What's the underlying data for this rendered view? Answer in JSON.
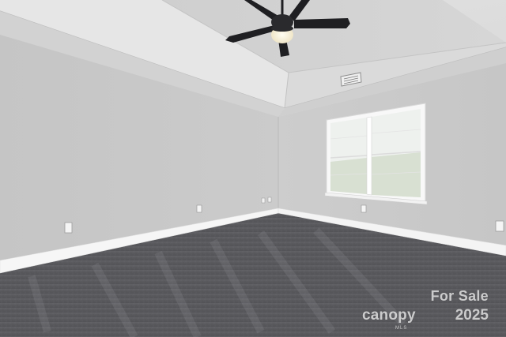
{
  "watermark": {
    "tag": "For Sale",
    "brand": "canopy",
    "sub": "MLS",
    "year": "2025"
  },
  "colors": {
    "wall": "#c9c9c9",
    "ceiling": "#dedede",
    "trim": "#f7f7f7",
    "carpet": "#5a5a5e",
    "fan_blade": "#1f1f22"
  }
}
